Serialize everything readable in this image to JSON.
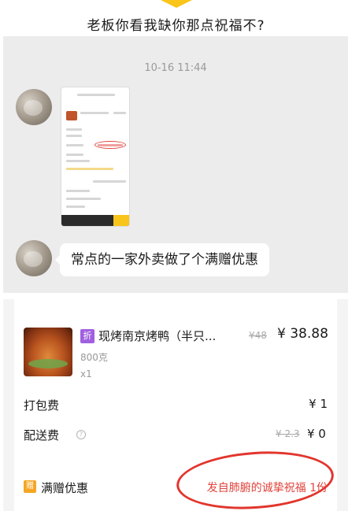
{
  "caption": {
    "text": "老板你看我缺你那点祝福不?"
  },
  "chat": {
    "timestamp": "10-16 11:44",
    "message": "常点的一家外卖做了个满赠优惠"
  },
  "order": {
    "item": {
      "tag": "折",
      "name": "现烤南京烤鸭（半只...",
      "original_price": "¥48",
      "price": "¥ 38.88",
      "spec": "800克",
      "quantity": "x1"
    },
    "packaging": {
      "label": "打包费",
      "value": "¥ 1"
    },
    "delivery": {
      "label": "配送费",
      "info_symbol": "?",
      "original_value": "¥ 2.3",
      "value": "¥ 0"
    },
    "gift": {
      "icon_text": "赠",
      "label": "满赠优惠",
      "value": "发自肺腑的诚挚祝福 1份"
    }
  },
  "colors": {
    "accent": "#f9c51b",
    "highlight": "#e0443c",
    "promo": "#a060e0"
  }
}
